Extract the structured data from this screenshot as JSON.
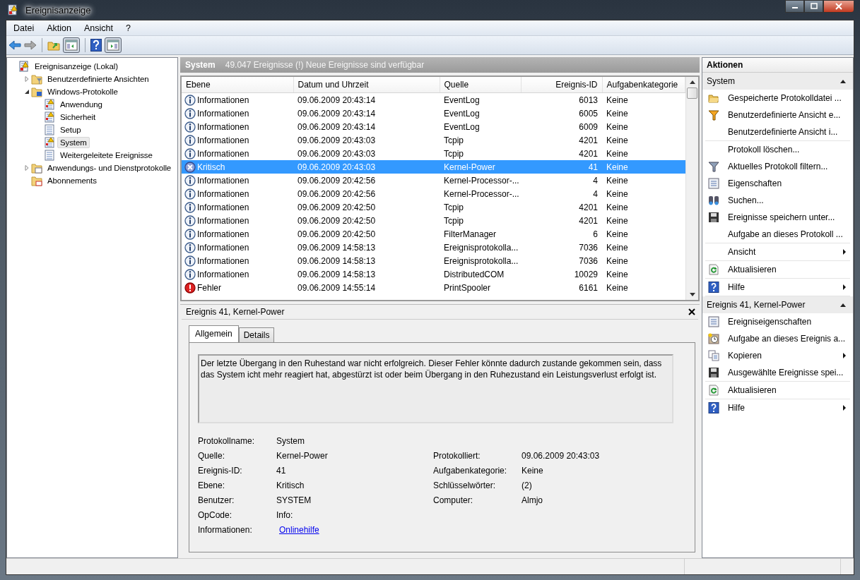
{
  "window": {
    "title": "Ereignisanzeige"
  },
  "menu": [
    "Datei",
    "Aktion",
    "Ansicht",
    "?"
  ],
  "tree": [
    {
      "label": "Ereignisanzeige (Lokal)",
      "kind": "viewer",
      "selected": false,
      "children": [
        {
          "label": "Benutzerdefinierte Ansichten",
          "kind": "folder-filter",
          "selected": false,
          "expanded": false
        },
        {
          "label": "Windows-Protokolle",
          "kind": "folder-windows",
          "selected": false,
          "expanded": true,
          "children": [
            {
              "label": "Anwendung",
              "kind": "log-warn",
              "selected": false
            },
            {
              "label": "Sicherheit",
              "kind": "log-warn",
              "selected": false
            },
            {
              "label": "Setup",
              "kind": "log",
              "selected": false
            },
            {
              "label": "System",
              "kind": "log-warn",
              "selected": true
            },
            {
              "label": "Weitergeleitete Ereignisse",
              "kind": "log",
              "selected": false
            }
          ]
        },
        {
          "label": "Anwendungs- und Dienstprotokolle",
          "kind": "folder-app",
          "selected": false,
          "expanded": false
        },
        {
          "label": "Abonnements",
          "kind": "folder-sub",
          "selected": false
        }
      ]
    }
  ],
  "list_header": {
    "title": "System",
    "info": "49.047 Ereignisse (!) Neue Ereignisse sind verfügbar"
  },
  "columns": [
    {
      "label": "Ebene",
      "kind": "text"
    },
    {
      "label": "Datum und Uhrzeit",
      "kind": "text"
    },
    {
      "label": "Quelle",
      "kind": "text"
    },
    {
      "label": "Ereignis-ID",
      "kind": "number"
    },
    {
      "label": "Aufgabenkategorie",
      "kind": "text"
    }
  ],
  "events": [
    {
      "kind": "info",
      "level": "Informationen",
      "date": "09.06.2009 20:43:14",
      "source": "EventLog",
      "id": "6013",
      "category": "Keine",
      "selected": false
    },
    {
      "kind": "info",
      "level": "Informationen",
      "date": "09.06.2009 20:43:14",
      "source": "EventLog",
      "id": "6005",
      "category": "Keine",
      "selected": false
    },
    {
      "kind": "info",
      "level": "Informationen",
      "date": "09.06.2009 20:43:14",
      "source": "EventLog",
      "id": "6009",
      "category": "Keine",
      "selected": false
    },
    {
      "kind": "info",
      "level": "Informationen",
      "date": "09.06.2009 20:43:03",
      "source": "Tcpip",
      "id": "4201",
      "category": "Keine",
      "selected": false
    },
    {
      "kind": "info",
      "level": "Informationen",
      "date": "09.06.2009 20:43:03",
      "source": "Tcpip",
      "id": "4201",
      "category": "Keine",
      "selected": false
    },
    {
      "kind": "critical",
      "level": "Kritisch",
      "date": "09.06.2009 20:43:03",
      "source": "Kernel-Power",
      "id": "41",
      "category": "Keine",
      "selected": true
    },
    {
      "kind": "info",
      "level": "Informationen",
      "date": "09.06.2009 20:42:56",
      "source": "Kernel-Processor-...",
      "id": "4",
      "category": "Keine",
      "selected": false
    },
    {
      "kind": "info",
      "level": "Informationen",
      "date": "09.06.2009 20:42:56",
      "source": "Kernel-Processor-...",
      "id": "4",
      "category": "Keine",
      "selected": false
    },
    {
      "kind": "info",
      "level": "Informationen",
      "date": "09.06.2009 20:42:50",
      "source": "Tcpip",
      "id": "4201",
      "category": "Keine",
      "selected": false
    },
    {
      "kind": "info",
      "level": "Informationen",
      "date": "09.06.2009 20:42:50",
      "source": "Tcpip",
      "id": "4201",
      "category": "Keine",
      "selected": false
    },
    {
      "kind": "info",
      "level": "Informationen",
      "date": "09.06.2009 20:42:50",
      "source": "FilterManager",
      "id": "6",
      "category": "Keine",
      "selected": false
    },
    {
      "kind": "info",
      "level": "Informationen",
      "date": "09.06.2009 14:58:13",
      "source": "Ereignisprotokolla...",
      "id": "7036",
      "category": "Keine",
      "selected": false
    },
    {
      "kind": "info",
      "level": "Informationen",
      "date": "09.06.2009 14:58:13",
      "source": "Ereignisprotokolla...",
      "id": "7036",
      "category": "Keine",
      "selected": false
    },
    {
      "kind": "info",
      "level": "Informationen",
      "date": "09.06.2009 14:58:13",
      "source": "DistributedCOM",
      "id": "10029",
      "category": "Keine",
      "selected": false
    },
    {
      "kind": "error",
      "level": "Fehler",
      "date": "09.06.2009 14:55:14",
      "source": "PrintSpooler",
      "id": "6161",
      "category": "Keine",
      "selected": false
    }
  ],
  "detail": {
    "title": "Ereignis 41, Kernel-Power",
    "tabs": [
      {
        "label": "Allgemein",
        "selected": true
      },
      {
        "label": "Details",
        "selected": false
      }
    ],
    "description": "Der letzte Übergang in den Ruhestand war nicht erfolgreich. Dieser Fehler könnte dadurch zustande gekommen sein, dass das System icht mehr reagiert hat, abgestürzt ist oder beim Übergang in den Ruhezustand ein Leistungsverlust erfolgt ist.",
    "rows": [
      {
        "left": {
          "label": "Protokollname:",
          "value": "System"
        }
      },
      {
        "left": {
          "label": "Quelle:",
          "value": "Kernel-Power"
        },
        "right": {
          "label": "Protokolliert:",
          "value": "09.06.2009 20:43:03"
        }
      },
      {
        "left": {
          "label": "Ereignis-ID:",
          "value": "41"
        },
        "right": {
          "label": "Aufgabenkategorie:",
          "value": "Keine"
        }
      },
      {
        "left": {
          "label": "Ebene:",
          "value": "Kritisch"
        },
        "right": {
          "label": "Schlüsselwörter:",
          "value": "(2)"
        }
      },
      {
        "left": {
          "label": "Benutzer:",
          "value": "SYSTEM"
        },
        "right": {
          "label": "Computer:",
          "value": "Almjo"
        }
      },
      {
        "left": {
          "label": "OpCode:",
          "value": "Info:"
        }
      },
      {
        "left": {
          "label": "Informationen:",
          "value": "Onlinehilfe",
          "kind": "link"
        }
      }
    ]
  },
  "actions": {
    "title": "Aktionen",
    "sections": [
      {
        "title": "System",
        "expanded": true,
        "groups": [
          [
            {
              "label": "Gespeicherte Protokolldatei ...",
              "kind": "open",
              "submenu": false
            },
            {
              "label": "Benutzerdefinierte Ansicht e...",
              "kind": "filter-color",
              "submenu": false
            },
            {
              "label": "Benutzerdefinierte Ansicht i...",
              "kind": "none",
              "submenu": false
            }
          ],
          [
            {
              "label": "Protokoll löschen...",
              "kind": "none",
              "submenu": false
            },
            {
              "label": "Aktuelles Protokoll filtern...",
              "kind": "filter",
              "submenu": false
            },
            {
              "label": "Eigenschaften",
              "kind": "properties",
              "submenu": false
            },
            {
              "label": "Suchen...",
              "kind": "search",
              "submenu": false
            },
            {
              "label": "Ereignisse speichern unter...",
              "kind": "save",
              "submenu": false
            },
            {
              "label": "Aufgabe an dieses Protokoll ...",
              "kind": "none",
              "submenu": false
            }
          ],
          [
            {
              "label": "Ansicht",
              "kind": "none",
              "submenu": true
            }
          ],
          [
            {
              "label": "Aktualisieren",
              "kind": "refresh",
              "submenu": false
            }
          ],
          [
            {
              "label": "Hilfe",
              "kind": "help",
              "submenu": true
            }
          ]
        ]
      },
      {
        "title": "Ereignis 41, Kernel-Power",
        "expanded": true,
        "groups": [
          [
            {
              "label": "Ereigniseigenschaften",
              "kind": "properties",
              "submenu": false
            },
            {
              "label": "Aufgabe an dieses Ereignis a...",
              "kind": "task",
              "submenu": false
            },
            {
              "label": "Kopieren",
              "kind": "copy",
              "submenu": true
            },
            {
              "label": "Ausgewählte Ereignisse spei...",
              "kind": "save",
              "submenu": false
            }
          ],
          [
            {
              "label": "Aktualisieren",
              "kind": "refresh",
              "submenu": false
            }
          ],
          [
            {
              "label": "Hilfe",
              "kind": "help",
              "submenu": true
            }
          ]
        ]
      }
    ]
  }
}
